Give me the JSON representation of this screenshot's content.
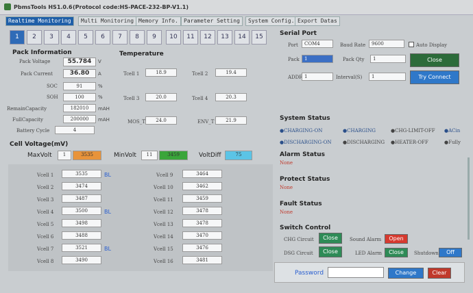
{
  "title": {
    "app": "PbmsTools HS1.0.6",
    "protocol": "(Protocol code:HS-PACE-232-BP-V1.1)"
  },
  "tabs": [
    "Realtime Monitoring",
    "Multi Monitoring",
    "Memory Info.",
    "Parameter Setting",
    "System Config.",
    "Export Datas"
  ],
  "packs": [
    "1",
    "2",
    "3",
    "4",
    "5",
    "6",
    "7",
    "8",
    "9",
    "10",
    "11",
    "12",
    "13",
    "14",
    "15"
  ],
  "pack_info": {
    "title": "Pack Information",
    "rows": [
      {
        "label": "Pack Voltage",
        "value": "55.784",
        "unit": "V"
      },
      {
        "label": "Pack Current",
        "value": "36.80",
        "unit": "A"
      },
      {
        "label": "SOC",
        "value": "91",
        "unit": "%"
      },
      {
        "label": "SOH",
        "value": "100",
        "unit": "%"
      },
      {
        "label": "RemainCapacity",
        "value": "182010",
        "unit": "mAH"
      },
      {
        "label": "FullCapacity",
        "value": "200000",
        "unit": "mAH"
      },
      {
        "label": "Battery Cycle",
        "value": "4",
        "unit": ""
      }
    ]
  },
  "temperature": {
    "title": "Temperature",
    "rows": [
      {
        "l1": "Tcell 1",
        "v1": "18.9",
        "l2": "Tcell 2",
        "v2": "19.4"
      },
      {
        "l1": "Tcell 3",
        "v1": "20.0",
        "l2": "Tcell 4",
        "v2": "20.3"
      },
      {
        "l1": "MOS_T",
        "v1": "24.0",
        "l2": "ENV_T",
        "v2": "21.9"
      }
    ]
  },
  "cell_voltage": {
    "title": "Cell Voltage(mV)",
    "max_label": "MaxVolt",
    "max_idx": "1",
    "max_val": "3535",
    "min_label": "MinVolt",
    "min_idx": "11",
    "min_val": "3459",
    "diff_label": "VoltDiff",
    "diff_val": "75",
    "left": [
      {
        "label": "Vcell 1",
        "value": "3535",
        "bl": "BL"
      },
      {
        "label": "Vcell 2",
        "value": "3474",
        "bl": ""
      },
      {
        "label": "Vcell 3",
        "value": "3487",
        "bl": ""
      },
      {
        "label": "Vcell 4",
        "value": "3500",
        "bl": "BL"
      },
      {
        "label": "Vcell 5",
        "value": "3498",
        "bl": ""
      },
      {
        "label": "Vcell 6",
        "value": "3488",
        "bl": ""
      },
      {
        "label": "Vcell 7",
        "value": "3521",
        "bl": "BL"
      },
      {
        "label": "Vcell 8",
        "value": "3490",
        "bl": ""
      }
    ],
    "right": [
      {
        "label": "Vcell 9",
        "value": "3464"
      },
      {
        "label": "Vcell 10",
        "value": "3462"
      },
      {
        "label": "Vcell 11",
        "value": "3459"
      },
      {
        "label": "Vcell 12",
        "value": "3478"
      },
      {
        "label": "Vcell 13",
        "value": "3478"
      },
      {
        "label": "Vcell 14",
        "value": "3470"
      },
      {
        "label": "Vcell 15",
        "value": "3476"
      },
      {
        "label": "Vcell 16",
        "value": "3481"
      }
    ]
  },
  "serial": {
    "title": "Serial Port",
    "port_label": "Port",
    "port_val": "COM4",
    "baud_label": "Baud Rate",
    "baud_val": "9600",
    "autodisp": "Auto Display",
    "pack_label": "Pack",
    "pack_val": "1",
    "packqty_label": "Pack Qty",
    "packqty_val": "1",
    "addr_label": "ADDR",
    "addr_val": "1",
    "interval_label": "Interval(S)",
    "interval_val": "1",
    "close_btn": "Close",
    "try_btn": "Try Connect"
  },
  "system_status": {
    "title": "System Status",
    "items": [
      "●CHARGING-ON",
      "●CHARGING",
      "●CHG-LIMIT-OFF",
      "●ACin",
      "●DISCHARGING-ON",
      "●DISCHARGING",
      "●HEATER-OFF",
      "●Fully"
    ]
  },
  "alarm": {
    "title": "Alarm Status",
    "value": "None"
  },
  "protect": {
    "title": "Protect Status",
    "value": "None"
  },
  "fault": {
    "title": "Fault Status",
    "value": "None"
  },
  "switch": {
    "title": "Switch Control",
    "chg_label": "CHG Circuit",
    "chg_btn": "Close",
    "sound_label": "Sound Alarm",
    "sound_btn": "Open",
    "dsg_label": "DSG Circuit",
    "dsg_btn": "Close",
    "led_label": "LED Alarm",
    "led_btn": "Close",
    "shutdown_label": "Shutdown",
    "shutdown_btn": "Off"
  },
  "password": {
    "label": "Password",
    "value": "",
    "change": "Change",
    "clear": "Clear"
  }
}
